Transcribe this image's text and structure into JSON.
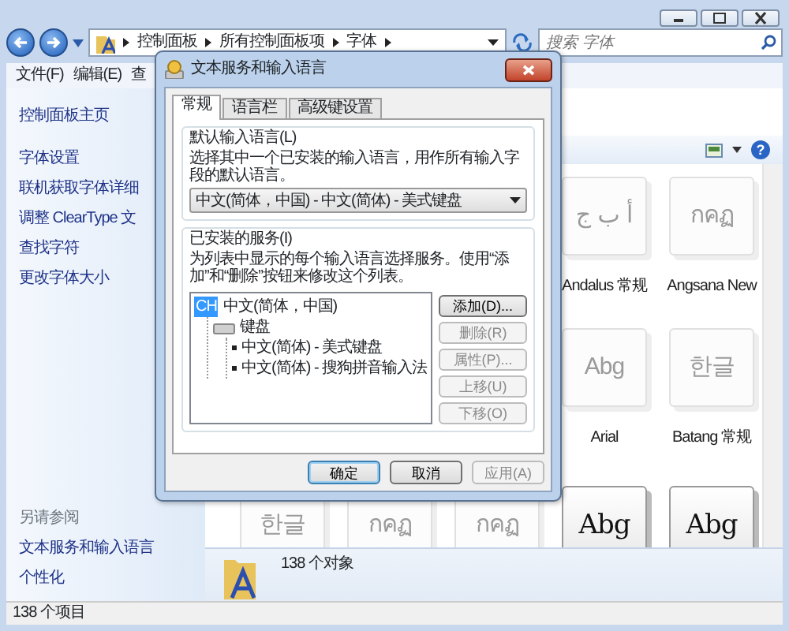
{
  "explorer": {
    "breadcrumb": [
      "控制面板",
      "所有控制面板项",
      "字体"
    ],
    "search": {
      "placeholder": "搜索 字体"
    },
    "menu": [
      "文件(F)",
      "编辑(E)",
      "查"
    ],
    "sidebar": {
      "links": [
        "控制面板主页",
        "字体设置",
        "联机获取字体详细",
        "调整 ClearType 文",
        "查找字符",
        "更改字体大小"
      ],
      "see_also_title": "另请参阅",
      "see_also": [
        "文本服务和输入语言",
        "个性化"
      ]
    },
    "help_glyph": "?",
    "font_rows": [
      [
        {
          "glyph": "أ ب ج",
          "label": "Andalus 常规",
          "kind": "faded"
        },
        {
          "glyph": "กคฏ",
          "label": "Angsana New",
          "kind": "faded"
        }
      ],
      [
        {
          "glyph": "Abg",
          "label": "Arial",
          "kind": "faded"
        },
        {
          "glyph": "한글",
          "label": "Batang 常规",
          "kind": "faded"
        }
      ],
      [
        {
          "glyph": "한글",
          "kind": "faded"
        },
        {
          "glyph": "กคฏ",
          "kind": "faded"
        },
        {
          "glyph": "กคฏ",
          "kind": "faded"
        },
        {
          "glyph": "Abg",
          "kind": "plain"
        },
        {
          "glyph": "Abg",
          "kind": "plain"
        }
      ]
    ],
    "details": "138 个对象",
    "status_bar": "138 个项目"
  },
  "dialog": {
    "title": "文本服务和输入语言",
    "tabs": [
      {
        "label": "常规",
        "selected": true
      },
      {
        "label": "语言栏",
        "selected": false
      },
      {
        "label": "高级键设置",
        "selected": false
      }
    ],
    "default_group": {
      "title": "默认输入语言(L)",
      "description": "选择其中一个已安装的输入语言，用作所有输入字段的默认语言。",
      "select_value": "中文(简体，中国) - 中文(简体) - 美式键盘"
    },
    "services_group": {
      "title": "已安装的服务(I)",
      "description": "为列表中显示的每个输入语言选择服务。使用“添加”和“删除”按钮来修改这个列表。",
      "tree": [
        {
          "badge": "CH",
          "label": "中文(简体，中国)",
          "children": [
            {
              "label": "键盘",
              "children": [
                {
                  "label": "中文(简体) - 美式键盘"
                },
                {
                  "label": "中文(简体) - 搜狗拼音输入法"
                }
              ]
            }
          ]
        }
      ],
      "buttons": [
        {
          "label": "添加(D)...",
          "disabled": false
        },
        {
          "label": "删除(R)",
          "disabled": true
        },
        {
          "label": "属性(P)...",
          "disabled": true
        },
        {
          "label": "上移(U)",
          "disabled": true
        },
        {
          "label": "下移(O)",
          "disabled": true
        }
      ]
    },
    "footer_buttons": [
      {
        "label": "确定",
        "disabled": false,
        "default": true
      },
      {
        "label": "取消",
        "disabled": false,
        "default": false
      },
      {
        "label": "应用(A)",
        "disabled": true,
        "default": false
      }
    ]
  }
}
